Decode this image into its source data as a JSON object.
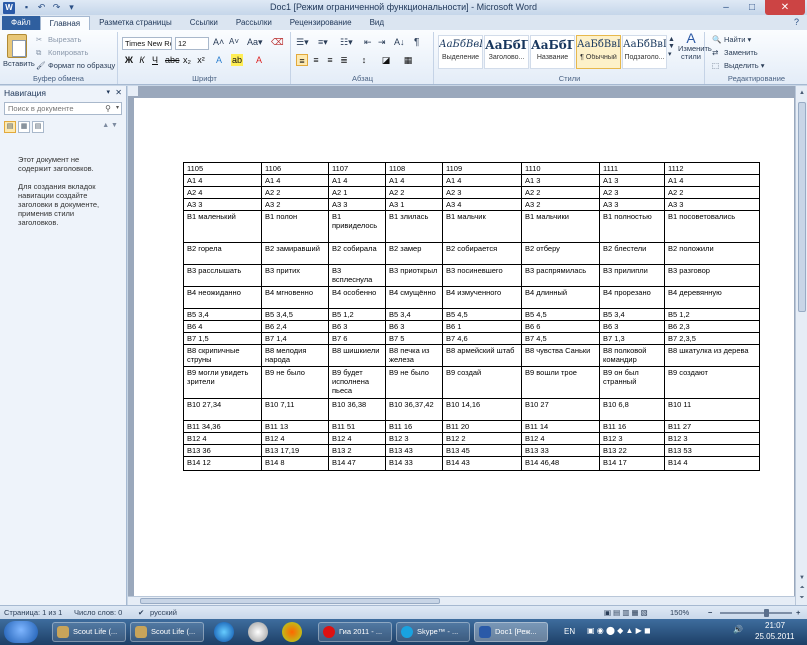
{
  "window": {
    "title": "Doc1 [Режим ограниченной функциональности] - Microsoft Word",
    "app_icon": "W"
  },
  "ribbon_tabs": {
    "file": "Файл",
    "items": [
      "Главная",
      "Разметка страницы",
      "Ссылки",
      "Рассылки",
      "Рецензирование",
      "Вид"
    ]
  },
  "ribbon": {
    "clipboard": {
      "paste": "Вставить",
      "cut": "Вырезать",
      "copy": "Копировать",
      "format_painter": "Формат по образцу",
      "label": "Буфер обмена"
    },
    "font": {
      "name": "Times New Rc",
      "size": "12",
      "label": "Шрифт"
    },
    "paragraph": {
      "label": "Абзац"
    },
    "styles": {
      "label": "Стили",
      "items": [
        {
          "preview": "АаБбВвГ",
          "name": "Выделение"
        },
        {
          "preview": "АаБбГ",
          "name": "Заголово..."
        },
        {
          "preview": "АаБбГ",
          "name": "Название"
        },
        {
          "preview": "АаБбВвI",
          "name": "¶ Обычный"
        },
        {
          "preview": "АаБбВвI",
          "name": "Подзаголо..."
        }
      ],
      "change_styles": "Изменить стили"
    },
    "editing": {
      "find": "Найти",
      "replace": "Заменить",
      "select": "Выделить",
      "label": "Редактирование"
    }
  },
  "nav_pane": {
    "title": "Навигация",
    "search_placeholder": "Поиск в документе",
    "message_1": "Этот документ не содержит заголовков.",
    "message_2": "Для создания вкладок навигации создайте заголовки в документе, применив стили заголовков."
  },
  "table": {
    "rows": [
      [
        "1105",
        "1106",
        "1107",
        "1108",
        "1109",
        "1110",
        "1111",
        "1112"
      ],
      [
        "А1 4",
        "А1 4",
        "А1 4",
        "А1 4",
        "А1 4",
        "А1 3",
        "А1 3",
        "А1 4"
      ],
      [
        "А2 4",
        "А2 2",
        "А2 1",
        "А2 2",
        "А2 3",
        "А2 2",
        "А2 3",
        "А2 2"
      ],
      [
        "А3 3",
        "А3 2",
        "А3 3",
        "А3 1",
        "А3 4",
        "А3 2",
        "А3 3",
        "А3 3"
      ],
      [
        "В1 маленький",
        "В1 полон",
        "В1 привиделось",
        "В1 злилась",
        "В1 мальчик",
        "В1 мальчики",
        "В1 полностью",
        "В1 посоветовались"
      ],
      [
        "В2 горела",
        "В2 замиравший",
        "В2 собирала",
        "В2 замер",
        "В2 собирается",
        "В2 отберу",
        "В2 блестели",
        "В2 положили"
      ],
      [
        "В3 расслышать",
        "В3 притих",
        "В3 всплеснула",
        "В3 приоткрыл",
        "В3 посиневшего",
        "В3 распрямилась",
        "В3 прилипли",
        "В3 разговор"
      ],
      [
        "В4 неожиданно",
        "В4 мгновенно",
        "В4 особенно",
        "В4 смущённо",
        "В4 измученного",
        "В4 длинный",
        "В4 прорезано",
        "В4 деревянную"
      ],
      [
        "В5 3,4",
        "В5 3,4,5",
        "В5 1,2",
        "В5 3,4",
        "В5 4,5",
        "В5 4,5",
        "В5 3,4",
        "В5 1,2"
      ],
      [
        "В6 4",
        "В6 2,4",
        "В6 3",
        "В6 3",
        "В6 1",
        "В6 6",
        "В6 3",
        "В6 2,3"
      ],
      [
        "В7 1,5",
        "В7 1,4",
        "В7 6",
        "В7 5",
        "В7 4,6",
        "В7 4,5",
        "В7 1,3",
        "В7 2,3,5"
      ],
      [
        "В8 скрипичные струны",
        "В8 мелодия народа",
        "В8 шишкиели",
        "В8 печка из железа",
        "В8 армейский штаб",
        "В8 чувства Саньки",
        "В8 полковой командир",
        "В8 шкатулка из дерева"
      ],
      [
        "В9 могли увидеть зрители",
        "В9 не было",
        "В9 будет исполнена пьеса",
        "В9 не было",
        "В9 создай",
        "В9 вошли трое",
        "В9 он был странный",
        "В9 создают"
      ],
      [
        "В10 27,34",
        "В10 7,11",
        "В10 36,38",
        "В10 36,37,42",
        "В10 14,16",
        "В10 27",
        "В10 6,8",
        "В10 11"
      ],
      [
        "В11 34,36",
        "В11 13",
        "В11 51",
        "В11 16",
        "В11 20",
        "В11 14",
        "В11 16",
        "В11 27"
      ],
      [
        "В12 4",
        "В12 4",
        "В12 4",
        "В12 3",
        "В12 2",
        "В12 4",
        "В12 3",
        "В12 3"
      ],
      [
        "В13 36",
        "В13 17,19",
        "В13 2",
        "В13 43",
        "В13 45",
        "В13 33",
        "В13 22",
        "В13 53"
      ],
      [
        "В14 12",
        "В14 8",
        "В14 47",
        "В14 33",
        "В14 43",
        "В14 46,48",
        "В14 17",
        "В14 4"
      ]
    ]
  },
  "status_bar": {
    "page": "Страница: 1 из 1",
    "words": "Число слов: 0",
    "language": "русский",
    "zoom": "150%"
  },
  "taskbar": {
    "buttons": [
      "Scout Life (...",
      "Scout Life (...",
      "Гиа 2011 - ...",
      "Skype™ - ...",
      "Doc1 [Реж..."
    ],
    "lang": "EN",
    "time": "21:07",
    "date": "25.05.2011"
  }
}
